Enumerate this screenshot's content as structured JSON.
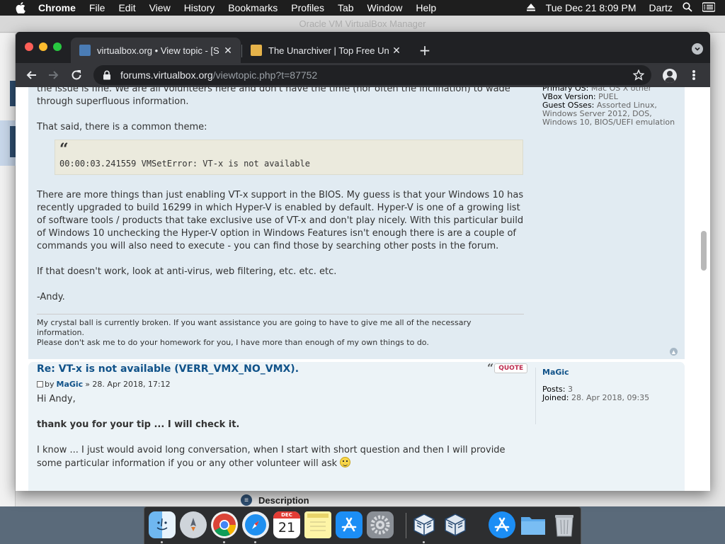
{
  "menubar": {
    "app_name": "Chrome",
    "menus": [
      "File",
      "Edit",
      "View",
      "History",
      "Bookmarks",
      "Profiles",
      "Tab",
      "Window",
      "Help"
    ],
    "clock": "Tue Dec 21  8:09 PM",
    "user": "Dartz"
  },
  "background_window": {
    "title": "Oracle VM VirtualBox Manager",
    "description_label": "Description"
  },
  "browser": {
    "tabs": [
      {
        "title": "virtualbox.org • View topic - [S",
        "active": true
      },
      {
        "title": "The Unarchiver | Top Free Una",
        "active": false
      }
    ],
    "url_host": "forums.virtualbox.org",
    "url_path": "/viewtopic.php?t=87752"
  },
  "post1": {
    "paragraph_top": "the issue is fine. We are all volunteers here and don't have the time (nor often the inclination) to wade through superfluous information.",
    "paragraph_theme": "That said, there is a common theme:",
    "quote_mark": "“",
    "quote_text": "00:00:03.241559 VMSetError: VT-x is not available",
    "paragraph_main": "There are more things than just enabling VT-x support in the BIOS. My guess is that your Windows 10 has recently upgraded to build 16299 in which Hyper-V is enabled by default. Hyper-V is one of a growing list of software tools / products that take exclusive use of VT-x and don't play nicely. With this particular build of Windows 10 unchecking the Hyper-V option in Windows Features isn't enough there is are a couple of commands you will also need to execute - you can find those by searching other posts in the forum.",
    "paragraph_av": "If that doesn't work, look at anti-virus, web filtering, etc. etc. etc.",
    "signoff": "-Andy.",
    "signature_line1": "My crystal ball is currently broken. If you want assistance you are going to have to give me all of the necessary information.",
    "signature_line2": "Please don't ask me to do your homework for you, I have more than enough of my own things to do.",
    "profile": {
      "primary_os_label": "Primary OS:",
      "primary_os_value": "Mac OS X other",
      "vbox_version_label": "VBox Version:",
      "vbox_version_value": "PUEL",
      "guest_oses_label": "Guest OSses:",
      "guest_oses_value": "Assorted Linux, Windows Server 2012, DOS, Windows 10, BIOS/UEFI emulation"
    }
  },
  "post2": {
    "title": "Re: VT-x is not available (VERR_VMX_NO_VMX).",
    "quote_button": "QUOTE",
    "meta_by": "by",
    "author": "MaGic",
    "meta_date": "» 28. Apr 2018, 17:12",
    "greeting": "Hi Andy,",
    "thanks": "thank you for your tip ... I will check it.",
    "paragraph": "I know ... I just would avoid long conversation, when I start with short question and then I will provide some particular information if you or any other volunteer will ask",
    "username": "MaGic",
    "posts_label": "Posts:",
    "posts_value": "3",
    "joined_label": "Joined:",
    "joined_value": "28. Apr 2018, 09:35"
  },
  "dock": {
    "calendar_month": "DEC",
    "calendar_day": "21"
  },
  "colors": {
    "link_blue": "#105289",
    "post_bg": "#e1ebf2",
    "quote_bg": "#ebeadd",
    "quote_button_red": "#bc2a4d"
  }
}
